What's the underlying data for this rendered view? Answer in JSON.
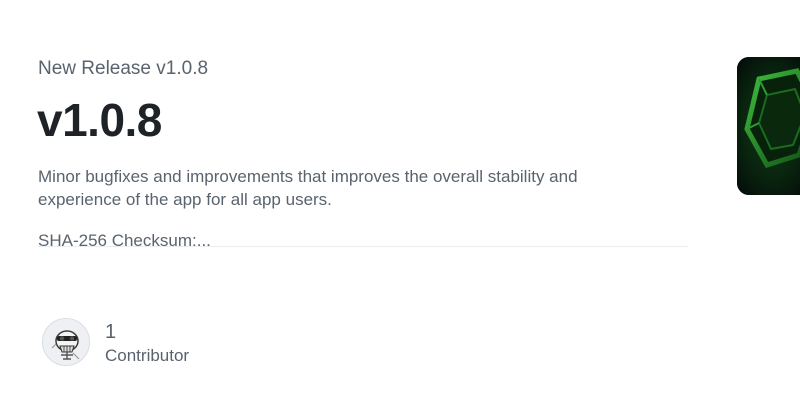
{
  "release": {
    "repo_line": "New Release v1.0.8",
    "title": "v1.0.8",
    "description_line1": "Minor bugfixes and improvements that improves the overall stability and",
    "description_line2": "experience of the app for all app users.",
    "checksum": "SHA-256 Checksum:..."
  },
  "preview": {
    "icon": "green-hexagon-app-icon"
  },
  "contributors": {
    "count": "1",
    "label": "Contributor",
    "avatar_icon": "skull-avatar-icon"
  },
  "colors": {
    "title": "#1f2328",
    "muted_text": "#59636e",
    "preview_background": "#05100a",
    "preview_accent": "#3fbf3f"
  }
}
